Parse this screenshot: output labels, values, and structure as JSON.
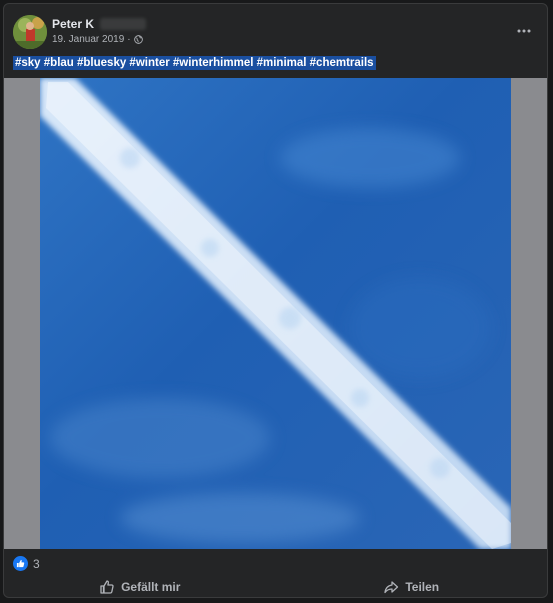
{
  "post": {
    "author": "Peter K",
    "date": "19. Januar 2019",
    "separator": "·",
    "privacy_icon": "globe-icon",
    "caption": "#sky #blau #bluesky #winter #winterhimmel #minimal #chemtrails",
    "reaction_count": "3",
    "actions": {
      "like_label": "Gefällt mir",
      "share_label": "Teilen"
    }
  },
  "colors": {
    "background": "#18191a",
    "card": "#242526",
    "caption_highlight": "#1a4fa0",
    "like_blue": "#1877f2",
    "sky_blue": "#1d5fb0"
  }
}
